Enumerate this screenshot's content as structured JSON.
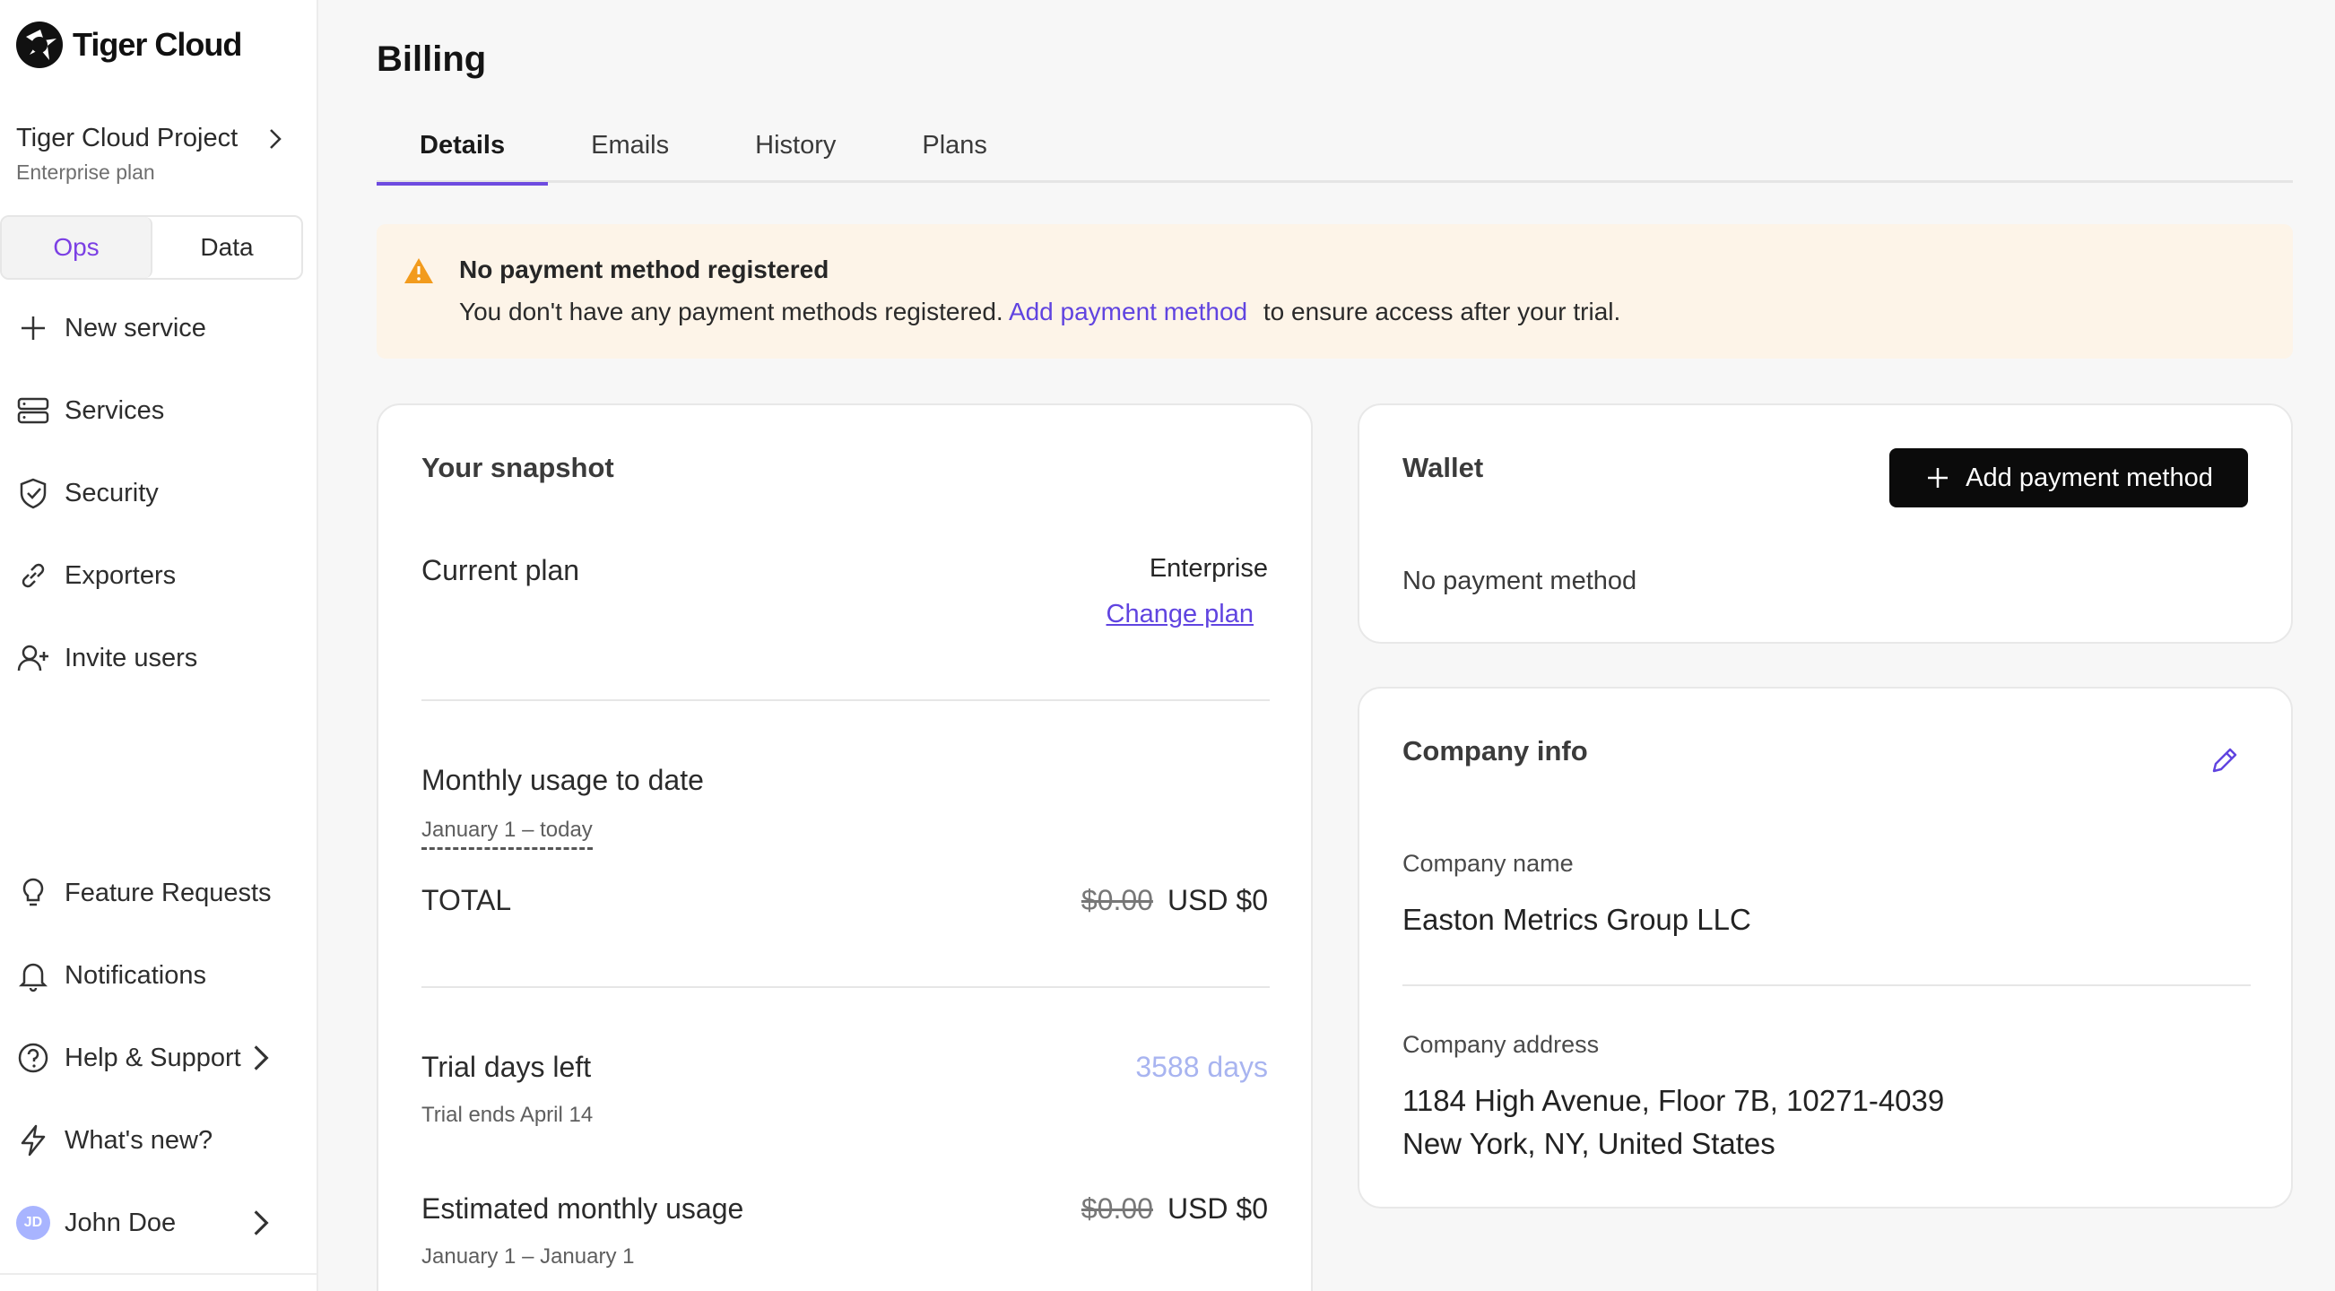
{
  "brand": {
    "name": "Tiger Cloud"
  },
  "project": {
    "name": "Tiger Cloud Project",
    "plan": "Enterprise plan"
  },
  "mode_toggle": {
    "ops": "Ops",
    "data": "Data",
    "active": "Ops"
  },
  "nav_top": [
    {
      "label": "New service",
      "icon": "plus-icon"
    },
    {
      "label": "Services",
      "icon": "server-icon"
    },
    {
      "label": "Security",
      "icon": "shield-check-icon"
    },
    {
      "label": "Exporters",
      "icon": "link-icon"
    },
    {
      "label": "Invite users",
      "icon": "user-plus-icon"
    }
  ],
  "nav_bottom": [
    {
      "label": "Feature Requests",
      "icon": "lightbulb-icon"
    },
    {
      "label": "Notifications",
      "icon": "bell-icon"
    },
    {
      "label": "Help & Support",
      "icon": "help-circle-icon"
    },
    {
      "label": "What's new?",
      "icon": "lightning-icon"
    }
  ],
  "user": {
    "initials": "JD",
    "name": "John Doe"
  },
  "page": {
    "title": "Billing"
  },
  "tabs": [
    {
      "label": "Details",
      "active": true
    },
    {
      "label": "Emails",
      "active": false
    },
    {
      "label": "History",
      "active": false
    },
    {
      "label": "Plans",
      "active": false
    }
  ],
  "alert": {
    "title": "No payment method registered",
    "body_prefix": "You don't have any payment methods registered.",
    "link": "Add payment method",
    "body_suffix": "to ensure access after your trial."
  },
  "snapshot": {
    "title": "Your snapshot",
    "current_plan_label": "Current plan",
    "current_plan_value": "Enterprise",
    "change_plan": "Change plan",
    "monthly_usage_label": "Monthly usage to date",
    "monthly_usage_range": "January 1 – today",
    "total_label": "TOTAL",
    "total_old": "$0.00",
    "total_new": "USD $0",
    "trial_label": "Trial days left",
    "trial_ends": "Trial ends April 14",
    "trial_days": "3588 days",
    "estimated_label": "Estimated monthly usage",
    "estimated_range": "January 1 – January 1",
    "estimated_old": "$0.00",
    "estimated_new": "USD $0"
  },
  "wallet": {
    "title": "Wallet",
    "add_button": "Add payment method",
    "empty": "No payment method"
  },
  "company": {
    "title": "Company info",
    "name_label": "Company name",
    "name_value": "Easton Metrics Group LLC",
    "address_label": "Company address",
    "address_line1": "1184 High Avenue, Floor 7B, 10271-4039",
    "address_line2": "New York, NY, United States"
  },
  "colors": {
    "accent": "#6044e0",
    "alert_bg": "#fdf4e8",
    "warning": "#f29b1d",
    "trial_days": "#a8b4f0"
  }
}
